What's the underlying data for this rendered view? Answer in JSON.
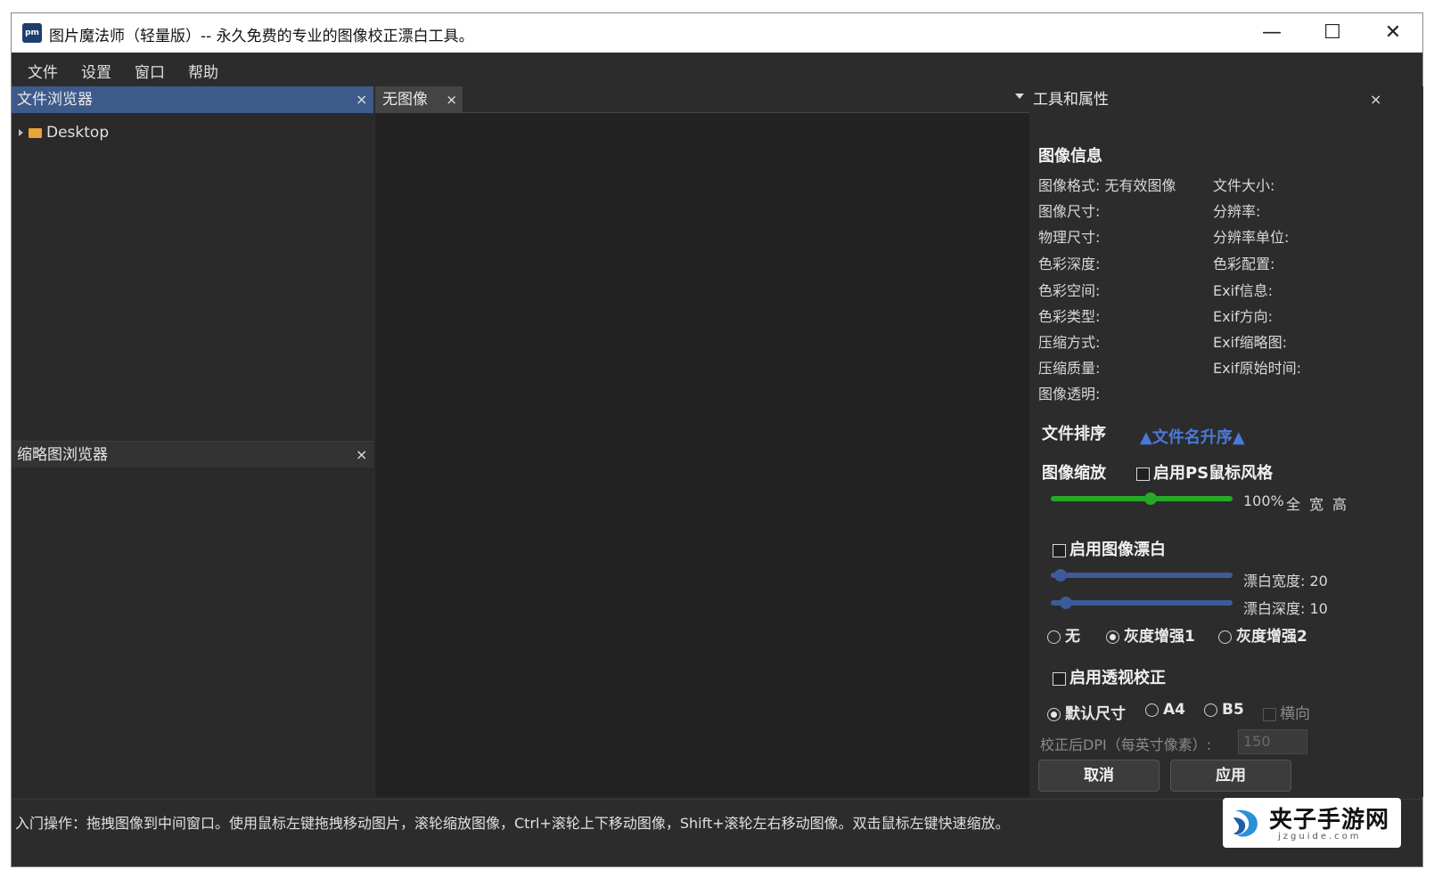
{
  "window": {
    "app_icon_text": "pm",
    "title": "图片魔法师（轻量版）-- 永久免费的专业的图像校正漂白工具。",
    "minimize_glyph": "—",
    "maximize_glyph": "☐",
    "close_glyph": "✕"
  },
  "menu": [
    "文件",
    "设置",
    "窗口",
    "帮助"
  ],
  "file_browser": {
    "title": "文件浏览器",
    "close": "×",
    "tree": [
      {
        "label": "Desktop"
      }
    ]
  },
  "thumbnail_browser": {
    "title": "缩略图浏览器",
    "close": "×"
  },
  "center": {
    "tab_label": "无图像",
    "tab_close": "×"
  },
  "right_panel": {
    "title": "工具和属性",
    "close": "×",
    "image_info": {
      "heading": "图像信息",
      "left": [
        {
          "label": "图像格式:",
          "value": "无有效图像"
        },
        {
          "label": "图像尺寸:",
          "value": ""
        },
        {
          "label": "物理尺寸:",
          "value": ""
        },
        {
          "label": "色彩深度:",
          "value": ""
        },
        {
          "label": "色彩空间:",
          "value": ""
        },
        {
          "label": "色彩类型:",
          "value": ""
        },
        {
          "label": "压缩方式:",
          "value": ""
        },
        {
          "label": "压缩质量:",
          "value": ""
        },
        {
          "label": "图像透明:",
          "value": ""
        }
      ],
      "right": [
        {
          "label": "文件大小:"
        },
        {
          "label": "分辨率:"
        },
        {
          "label": "分辨率单位:"
        },
        {
          "label": "色彩配置:"
        },
        {
          "label": "Exif信息:"
        },
        {
          "label": "Exif方向:"
        },
        {
          "label": "Exif缩略图:"
        },
        {
          "label": "Exif原始时间:"
        }
      ]
    },
    "sort": {
      "label": "文件排序",
      "value": "▲文件名升序▲"
    },
    "zoom": {
      "label": "图像缩放",
      "ps_style_label": "启用PS鼠标风格",
      "ps_style_checked": false,
      "value": 0.55,
      "percent_text": "100%",
      "full_label": "全",
      "width_label": "宽",
      "height_label": "高",
      "color": "#27a827"
    },
    "whiten": {
      "enable_label": "启用图像漂白",
      "enabled": false,
      "width_label": "漂白宽度:",
      "width_value": "20",
      "width_level": 0.02,
      "depth_label": "漂白深度:",
      "depth_value": "10",
      "depth_level": 0.05,
      "slider_color": "#3d5a9a",
      "modes": [
        {
          "label": "无",
          "selected": false
        },
        {
          "label": "灰度增强1",
          "selected": true
        },
        {
          "label": "灰度增强2",
          "selected": false
        }
      ]
    },
    "perspective": {
      "enable_label": "启用透视校正",
      "enabled": false,
      "sizes": [
        {
          "label": "默认尺寸",
          "selected": true
        },
        {
          "label": "A4",
          "selected": false
        },
        {
          "label": "B5",
          "selected": false
        }
      ],
      "landscape_label": "横向",
      "dpi_label": "校正后DPI（每英寸像素）:",
      "dpi_value": "150"
    },
    "cancel_label": "取消",
    "apply_label": "应用"
  },
  "statusbar": {
    "text": "入门操作：拖拽图像到中间窗口。使用鼠标左键拖拽移动图片，滚轮缩放图像，Ctrl+滚轮上下移动图像，Shift+滚轮左右移动图像。双击鼠标左键快速缩放。"
  },
  "watermark": {
    "text": "夹子手游网",
    "sub": "jzguide.com"
  }
}
